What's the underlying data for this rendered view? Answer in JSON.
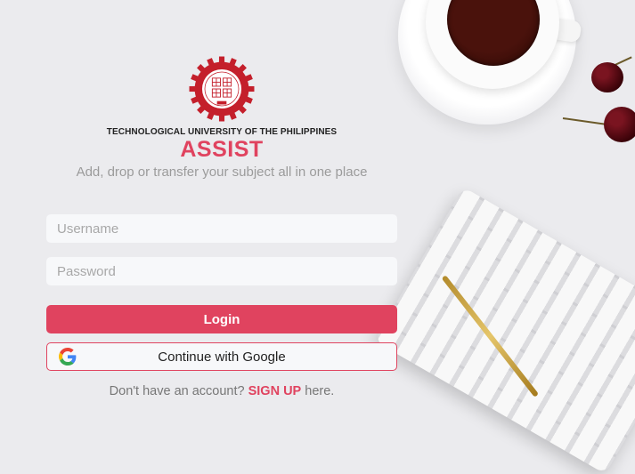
{
  "brand": {
    "university": "TECHNOLOGICAL UNIVERSITY OF THE PHILIPPINES",
    "app_name": "ASSIST",
    "tagline": "Add, drop or transfer your subject all in one place",
    "logo": "tup-seal",
    "accent_color": "#e0435f"
  },
  "form": {
    "username_placeholder": "Username",
    "username_value": "",
    "password_placeholder": "Password",
    "password_value": "",
    "login_label": "Login",
    "google_label": "Continue with Google",
    "google_icon": "google-g-icon"
  },
  "footer": {
    "prefix": "Don't have an account?",
    "signup_link": "SIGN UP",
    "suffix": "here."
  }
}
